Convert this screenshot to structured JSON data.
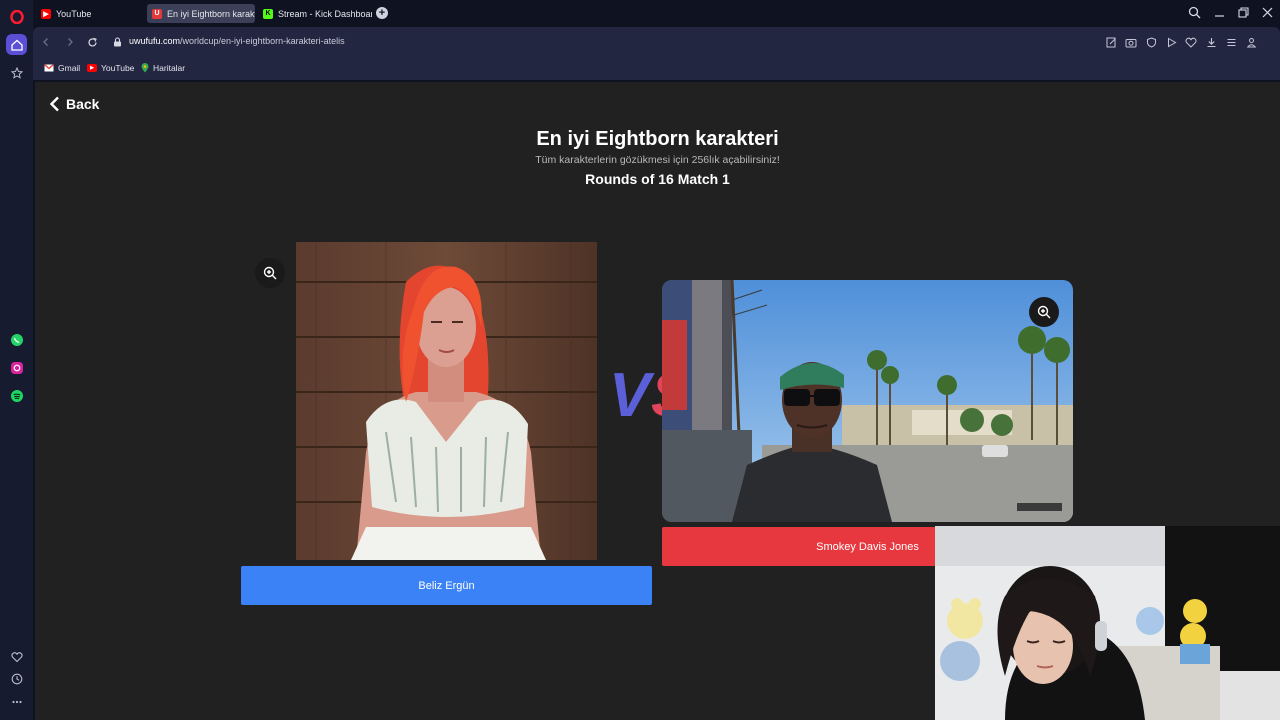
{
  "tabs": [
    {
      "label": "YouTube",
      "icon": "youtube-icon",
      "color": "#ff0000"
    },
    {
      "label": "En iyi Eightborn karakteri",
      "icon": "uwufufu-icon",
      "color": "#e23a3a"
    },
    {
      "label": "Stream - Kick Dashboard",
      "icon": "kick-icon",
      "color": "#53fc18"
    }
  ],
  "address": {
    "host": "uwufufu.com",
    "path": "/worldcup/en-iyi-eightborn-karakteri-atelis"
  },
  "bookmarks": [
    {
      "label": "Gmail",
      "icon": "gmail-icon"
    },
    {
      "label": "YouTube",
      "icon": "youtube-icon"
    },
    {
      "label": "Haritalar",
      "icon": "maps-icon"
    }
  ],
  "page": {
    "back_label": "Back",
    "title": "En iyi Eightborn karakteri",
    "subtitle": "Tüm karakterlerin gözükmesi için 256lık açabilirsiniz!",
    "round": "Rounds of 16 Match 1",
    "vs_text": "VS",
    "left_choice": {
      "name": "Beliz Ergün",
      "color": "#3b82f6"
    },
    "right_choice": {
      "name": "Smokey Davis Jones",
      "color": "#e8383f"
    }
  },
  "colors": {
    "accent": "#3b82f6",
    "opera_red": "#ff1b2d",
    "sidebar_active": "#5b4fd6"
  }
}
